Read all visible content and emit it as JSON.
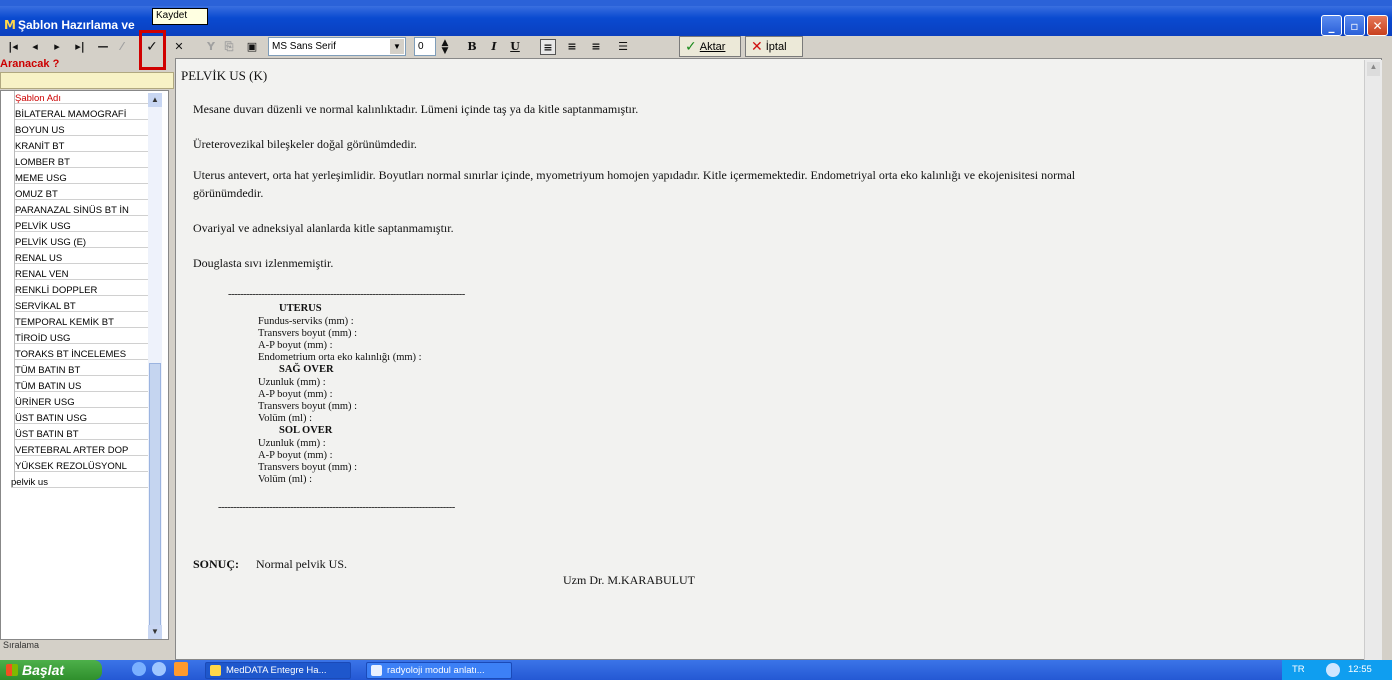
{
  "window": {
    "title": "Şablon Hazırlama ve",
    "tooltip": "Kaydet",
    "buttons": {
      "minimize": "_",
      "maximize": "▫",
      "close": "✕"
    }
  },
  "toolbar": {
    "nav": [
      "|◂",
      "◂",
      "▸",
      "▸|",
      "—",
      "⁄",
      "✓",
      "✕"
    ],
    "font_name": "MS Sans Serif",
    "font_size": "0",
    "format": [
      "B",
      "I",
      "U"
    ],
    "aktar_label": "Aktar",
    "iptal_label": "İptal"
  },
  "search": {
    "label": "Aranacak ?",
    "value": ""
  },
  "template_list": {
    "items": [
      "Şablon Adı",
      "BİLATERAL MAMOGRAFİ",
      "BOYUN US",
      "KRANİT BT",
      "LOMBER BT",
      "MEME USG",
      "OMUZ BT",
      "PARANAZAL SİNÜS BT İN",
      "PELVİK USG",
      "PELVİK USG (E)",
      "RENAL US",
      "RENAL VEN",
      "RENKLİ DOPPLER",
      "SERVİKAL BT",
      "TEMPORAL KEMİK BT",
      "TİROİD USG",
      "TORAKS BT İNCELEMES",
      "TÜM BATIN BT",
      "TÜM BATIN US",
      "ÜRİNER USG",
      "ÜST BATIN USG",
      "ÜST BATIN BT",
      "VERTEBRAL ARTER DOP",
      "YÜKSEK REZOLÜSYONL",
      "pelvik us"
    ],
    "sort_label": "Sıralama"
  },
  "document": {
    "title": "PELVİK US (K)",
    "paragraphs": [
      "Mesane duvarı düzenli ve normal kalınlıktadır. Lümeni içinde taş ya da kitle saptanmamıştır.",
      "Üreterovezikal bileşkeler doğal görünümdedir.",
      "Uterus antevert, orta hat yerleşimlidir. Boyutları normal sınırlar içinde, myometriyum homojen yapıdadır. Kitle içermemektedir. Endometriyal orta eko kalınlığı ve ekojenisitesi normal",
      "görünümdedir.",
      "Ovariyal ve adneksiyal alanlarda kitle saptanmamıştır.",
      "Douglasta sıvı izlenmemiştir."
    ],
    "separator": "-------------------------------------------------------------------------------",
    "uterus_header": "UTERUS",
    "uterus_rows": [
      "Fundus-serviks (mm)    :",
      "Transvers boyut (mm) :",
      "A-P boyut (mm)           :",
      "Endometrium orta eko kalınlığı (mm)   :"
    ],
    "sag_header": "SAĞ OVER",
    "sag_rows": [
      "Uzunluk (mm)              :",
      "A-P boyut (mm)            :",
      "Transvers boyut (mm) :",
      "Volüm (ml)                   :"
    ],
    "sol_header": "SOL OVER",
    "sol_rows": [
      "Uzunluk (mm)              :",
      "A-P boyut (mm)            :",
      "Transvers boyut (mm) :",
      "Volüm (ml)                   :"
    ],
    "conclusion_label": "SONUÇ:",
    "conclusion_text": "Normal pelvik US.",
    "signature": "Uzm Dr. M.KARABULUT"
  },
  "taskbar": {
    "start_label": "Başlat",
    "tasks": [
      "MedDATA Entegre Ha...",
      "radyoloji modul anlatı..."
    ],
    "lang": "TR",
    "clock": "12:55"
  },
  "colors": {
    "accent": "#0a4ad0",
    "highlight": "#d00000",
    "search_bg": "#f7f2c6"
  }
}
